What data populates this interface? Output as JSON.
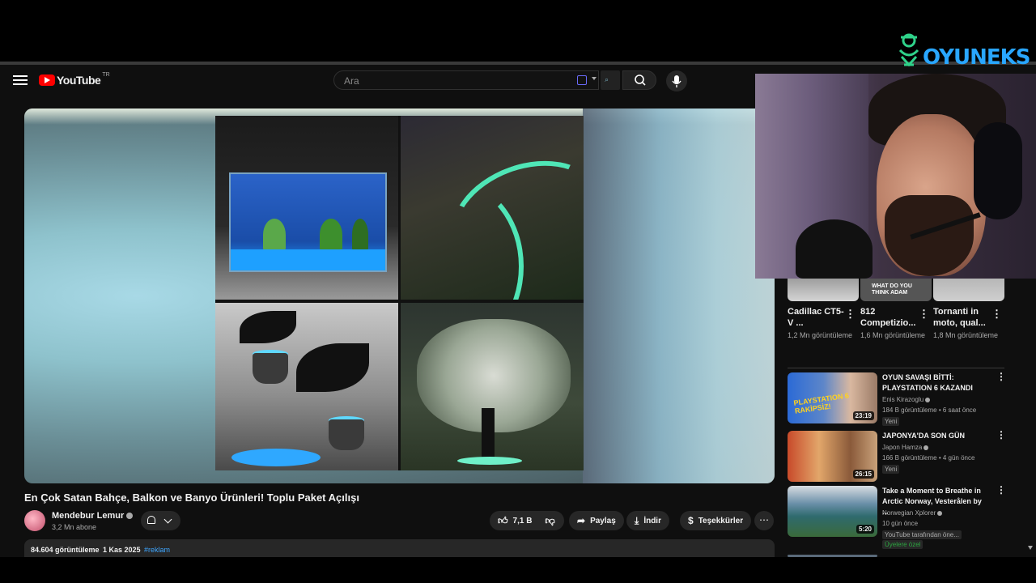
{
  "header": {
    "logo_text": "YouTube",
    "logo_country": "TR",
    "search_placeholder": "Ara"
  },
  "video": {
    "title": "En Çok Satan Bahçe, Balkon ve Banyo Ürünleri! Toplu Paket Açılışı",
    "channel": "Mendebur Lemur",
    "subscribers": "3,2 Mn abone",
    "likes": "7,1 B",
    "share_label": "Paylaş",
    "download_label": "İndir",
    "thanks_label": "Teşekkürler",
    "views": "84.604 görüntüleme",
    "date": "1 Kas 2025",
    "hashtag": "#reklam"
  },
  "top_recs": [
    {
      "title": "Cadillac CT5-V ...",
      "views": "1,2 Mn görüntüleme"
    },
    {
      "title": "812 Competizio...",
      "views": "1,6 Mn görüntüleme",
      "thumb_text": "WHAT DO YOU THINK ADAM"
    },
    {
      "title": "Tornanti in moto, qual...",
      "views": "1,8 Mn görüntüleme"
    }
  ],
  "recs": [
    {
      "title": "OYUN SAVAŞI BİTTİ: PLAYSTATION 6 KAZANDI",
      "channel": "Enis Kirazoglu",
      "meta": "184 B görüntüleme • 6 saat önce",
      "badge": "Yeni",
      "duration": "23:19",
      "thumb_text": "PLAYSTATION 6 RAKİPSİZ!"
    },
    {
      "title": "JAPONYA'DA SON GÜN",
      "channel": "Japon Hamza",
      "meta": "166 B görüntüleme • 4 gün önce",
      "badge": "Yeni",
      "duration": "26:15"
    },
    {
      "title": "Take a Moment to Breathe in Arctic Norway, Vesterålen by ...",
      "channel": "Norwegian Xplorer",
      "meta": "10 gün önce",
      "badge": "YouTube tarafından öne...",
      "badge2": "Üyelere özel",
      "duration": "5:20"
    }
  ],
  "watermark": {
    "brand": "OYUNEKS"
  },
  "colors": {
    "background": "#0f0f0f",
    "accent_red": "#ff0000",
    "link_blue": "#3ea6ff",
    "brand_blue": "#29a6ff",
    "member_green": "#2ba640"
  }
}
